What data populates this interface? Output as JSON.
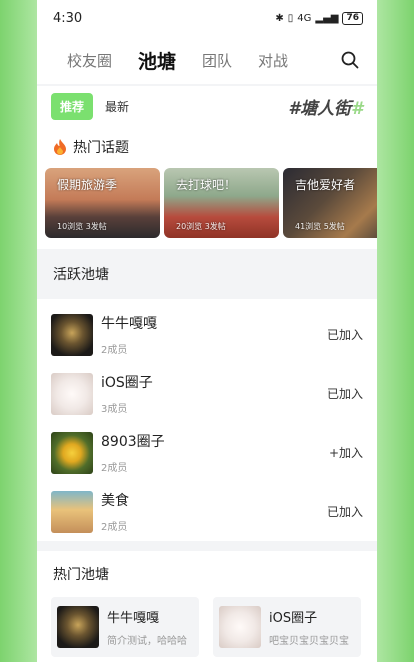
{
  "status": {
    "time": "4:30",
    "battery": "76",
    "network": "4G"
  },
  "nav": {
    "tabs": [
      "校友圈",
      "池塘",
      "团队",
      "对战"
    ],
    "active_index": 1
  },
  "feed_filters": {
    "recommend": "推荐",
    "latest": "最新"
  },
  "slogan": {
    "hash1": "#",
    "text": "塘人街",
    "hash2": "#"
  },
  "hot_topics": {
    "title": "热门话题",
    "items": [
      {
        "title": "假期旅游季",
        "meta": "10浏览 3发帖"
      },
      {
        "title": "去打球吧！",
        "meta": "20浏览 3发帖"
      },
      {
        "title": "吉他爱好者",
        "meta": "41浏览 5发帖"
      }
    ]
  },
  "active_ponds": {
    "title": "活跃池塘",
    "items": [
      {
        "name": "牛牛嘎嘎",
        "members": "2成员",
        "action": "已加入"
      },
      {
        "name": "iOS圈子",
        "members": "3成员",
        "action": "已加入"
      },
      {
        "name": "8903圈子",
        "members": "2成员",
        "action": "+加入"
      },
      {
        "name": "美食",
        "members": "2成员",
        "action": "已加入"
      }
    ]
  },
  "hot_ponds": {
    "title": "热门池塘",
    "items": [
      {
        "name": "牛牛嘎嘎",
        "desc": "简介测试，哈哈哈"
      },
      {
        "name": "iOS圈子",
        "desc": "吧宝贝宝贝宝贝宝"
      }
    ]
  },
  "colors": {
    "accent": "#7be06f"
  }
}
